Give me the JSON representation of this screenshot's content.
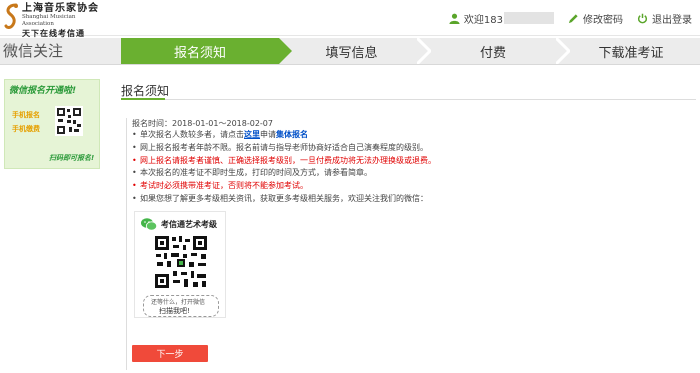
{
  "header": {
    "logo": {
      "cn": "上海音乐家协会",
      "en": "Shanghai Musician Association",
      "cn2": "天下在线考信通"
    },
    "welcome_label": "欢迎183",
    "change_password": "修改密码",
    "logout": "退出登录"
  },
  "sidebar": {
    "title": "微信关注",
    "banner": {
      "title": "微信报名开通啦!",
      "line1": "手机报名",
      "line2": "手机缴费",
      "footer": "扫码即可报名!"
    }
  },
  "steps": [
    {
      "label": "报名须知",
      "active": true
    },
    {
      "label": "填写信息",
      "active": false
    },
    {
      "label": "付费",
      "active": false
    },
    {
      "label": "下载准考证",
      "active": false
    }
  ],
  "main": {
    "section_title": "报名须知",
    "time": "报名时间：2018-01-01～2018-02-07",
    "notes": {
      "n1_pre": "单次报名人数较多者，请点击",
      "n1_link": "这里",
      "n1_mid": "申请",
      "n1_bold": "集体报名",
      "n2": "网上报名报考者年龄不限。报名前请与指导老师协商好适合自己演奏程度的级别。",
      "n3": "网上报名请报考者谨慎、正确选择报考级别，一旦付费成功将无法办理换级或退费。",
      "n4": "本次报名的准考证不即时生成，打印的时间及方式，请参看简章。",
      "n5": "考试时必须携带准考证，否则将不能参加考试。",
      "n6": "如果您想了解更多考级相关资讯，获取更多考级相关服务，欢迎关注我们的微信："
    },
    "qr_card": {
      "title": "考信通艺术考级",
      "hand1": "还等什么，打开微信",
      "hand2": "扫描我吧!"
    },
    "next_button": "下一步"
  },
  "colors": {
    "accent_green": "#6ab030",
    "button_red": "#f04a3a",
    "warning_red": "#e00000",
    "link_blue": "#0050c8"
  }
}
